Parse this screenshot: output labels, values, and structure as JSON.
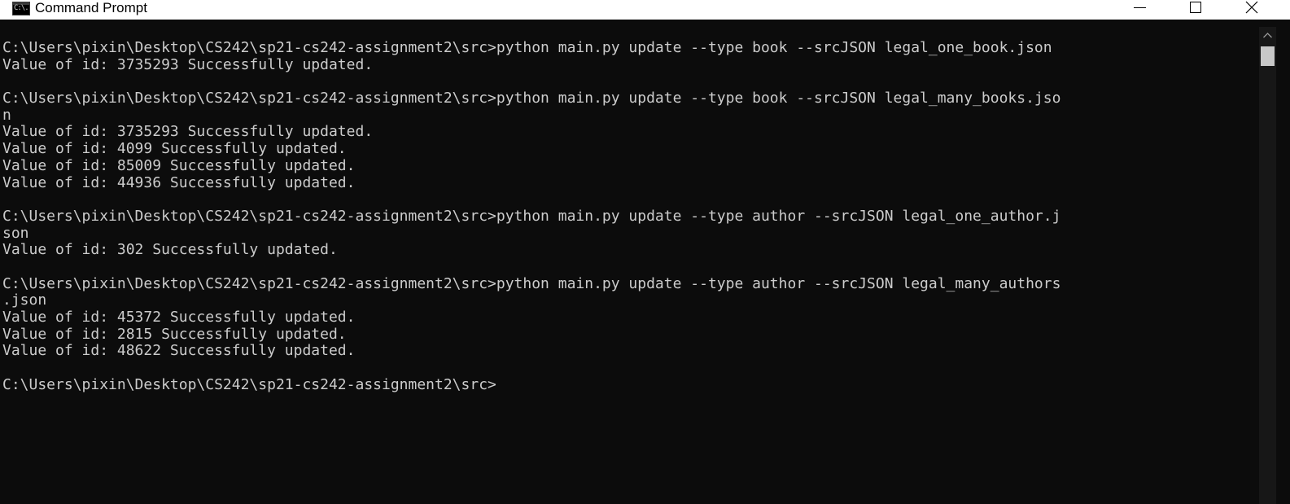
{
  "window": {
    "title": "Command Prompt",
    "icon_text": "C:\\."
  },
  "console": {
    "lines": [
      "C:\\Users\\pixin\\Desktop\\CS242\\sp21-cs242-assignment2\\src>python main.py update --type book --srcJSON legal_one_book.json",
      "Value of id: 3735293 Successfully updated.",
      "",
      "C:\\Users\\pixin\\Desktop\\CS242\\sp21-cs242-assignment2\\src>python main.py update --type book --srcJSON legal_many_books.jso",
      "n",
      "Value of id: 3735293 Successfully updated.",
      "Value of id: 4099 Successfully updated.",
      "Value of id: 85009 Successfully updated.",
      "Value of id: 44936 Successfully updated.",
      "",
      "C:\\Users\\pixin\\Desktop\\CS242\\sp21-cs242-assignment2\\src>python main.py update --type author --srcJSON legal_one_author.j",
      "son",
      "Value of id: 302 Successfully updated.",
      "",
      "C:\\Users\\pixin\\Desktop\\CS242\\sp21-cs242-assignment2\\src>python main.py update --type author --srcJSON legal_many_authors",
      ".json",
      "Value of id: 45372 Successfully updated.",
      "Value of id: 2815 Successfully updated.",
      "Value of id: 48622 Successfully updated.",
      "",
      "C:\\Users\\pixin\\Desktop\\CS242\\sp21-cs242-assignment2\\src>"
    ]
  },
  "colors": {
    "background": "#0c0c0c",
    "text": "#cccccc",
    "titlebar": "#ffffff"
  }
}
